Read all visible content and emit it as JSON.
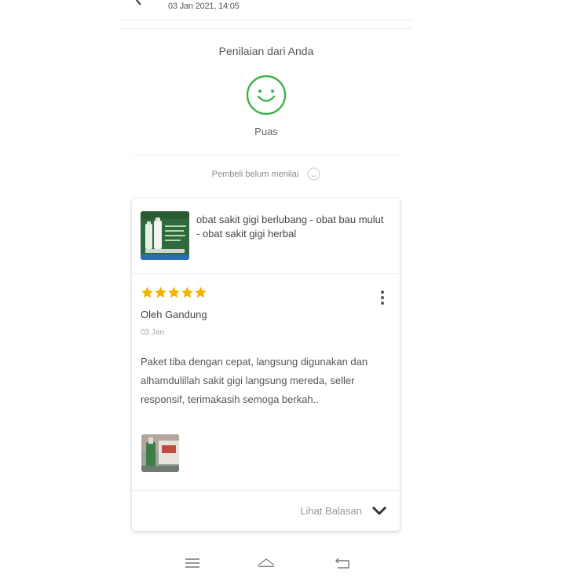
{
  "header": {
    "date": "03 Jan 2021, 14:05"
  },
  "rating": {
    "title": "Penilaian dari Anda",
    "label": "Puas",
    "icon": "smiley-icon",
    "accent_color": "#3db24a"
  },
  "buyer_status": {
    "text": "Pembeli belum menilai",
    "icon": "neutral-smiley-icon"
  },
  "review": {
    "product_name": "obat sakit gigi berlubang - obat bau mulut - obat sakit gigi herbal",
    "stars": 5,
    "star_color": "#f5b301",
    "reviewer": "Oleh Gandung",
    "date": "03 Jan",
    "text": "Paket tiba dengan cepat, langsung digunakan dan alhamdulillah sakit gigi langsung mereda, seller responsif, terimakasih semoga berkah..",
    "footer_link": "Lihat Balasan"
  },
  "navbar": {
    "icons": [
      "menu-icon",
      "home-icon",
      "back-nav-icon"
    ]
  }
}
